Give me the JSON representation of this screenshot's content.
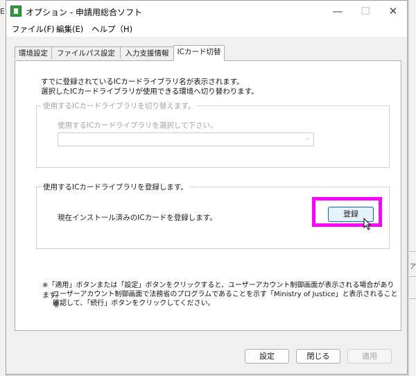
{
  "background": {
    "left_label": "E",
    "right_label": "ア"
  },
  "window": {
    "title": "オプション - 申請用総合ソフト",
    "controls": {
      "minimize": "—",
      "maximize": "☐",
      "close": "✕"
    }
  },
  "menu": [
    "ファイル(F)",
    "編集(E)",
    "ヘルプ（H)"
  ],
  "tabs": [
    "環境設定",
    "ファイルパス設定",
    "入力支援情報",
    "ICカード切替"
  ],
  "active_tab": "ICカード切替",
  "description": {
    "line1": "すでに登録されているICカードライブラリ名が表示されます。",
    "line2": "選択したICカードライブラリが使用できる環境へ切り替わります。"
  },
  "switch_group": {
    "legend": "使用するICカードライブラリを切り替えます。",
    "prompt": "使用するICカードライブラリを選択して下さい。",
    "select_value": ""
  },
  "register_group": {
    "legend": "使用するICカードライブラリを登録します。",
    "text": "現在インストール済みのICカードを登録します。",
    "button": "登録"
  },
  "note": {
    "line1": "※「適用」ボタンまたは「設定」ボタンをクリックすると、ユーザーアカウント制御画面が表示される場合があります。",
    "line2": "ユーザーアカウント制御画面で法務省のプログラムであることを示す「Ministry of Justice」と表示されることを",
    "line3": "確認して、「続行」ボタンをクリックしてください。"
  },
  "footer": {
    "settings": "設定",
    "close": "閉じる",
    "apply": "適用"
  },
  "colors": {
    "highlight": "#ff00ff",
    "accent": "#0067c0",
    "disabled_text": "#a3a3a3"
  },
  "icons": {
    "app": "app-icon",
    "dropdown": "chevron-down-icon",
    "pointer": "mouse-cursor-icon"
  }
}
